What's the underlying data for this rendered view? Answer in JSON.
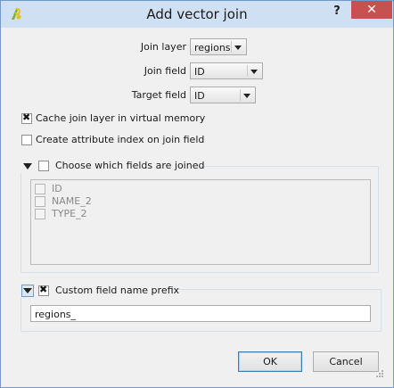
{
  "window": {
    "title": "Add vector join",
    "help_glyph": "?",
    "close_glyph": "✕",
    "icon": "qgis-logo-icon"
  },
  "form": {
    "join_layer": {
      "label": "Join layer",
      "value": "regions"
    },
    "join_field": {
      "label": "Join field",
      "value": "ID"
    },
    "target_field": {
      "label": "Target field",
      "value": "ID"
    }
  },
  "options": {
    "cache": {
      "label": "Cache join layer in virtual memory",
      "checked": true
    },
    "index": {
      "label": "Create attribute index on join field",
      "checked": false
    }
  },
  "fields_group": {
    "label": "Choose which fields are joined",
    "checked": false,
    "fields": [
      {
        "name": "ID",
        "checked": false
      },
      {
        "name": "NAME_2",
        "checked": false
      },
      {
        "name": "TYPE_2",
        "checked": false
      }
    ]
  },
  "prefix_group": {
    "label": "Custom field name prefix",
    "checked": true,
    "value": "regions_"
  },
  "buttons": {
    "ok": "OK",
    "cancel": "Cancel"
  }
}
